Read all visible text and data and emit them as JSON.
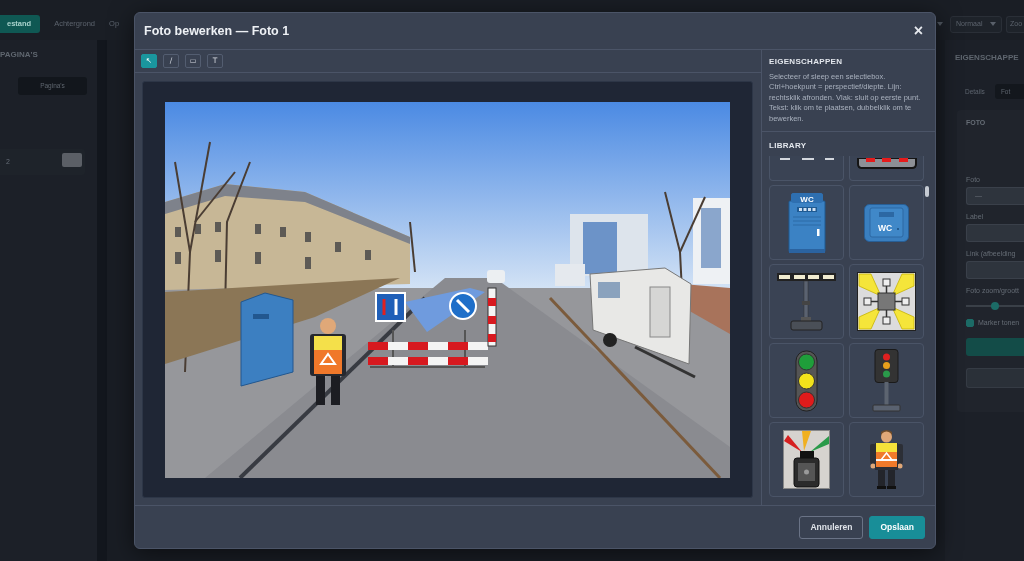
{
  "background_app": {
    "toolbar": [
      {
        "label": "estand",
        "selected": true
      },
      {
        "label": "Achtergrond",
        "selected": false
      },
      {
        "label": "Op",
        "selected": false
      }
    ],
    "view_selects": [
      {
        "label": "Normaal"
      },
      {
        "label": "Zoo"
      }
    ],
    "pages_panel": {
      "title": "PAGINA'S",
      "button": "Pagina's",
      "page_field": {
        "value": "2"
      }
    },
    "properties_panel": {
      "title": "EIGENSCHAPPE",
      "tabs": [
        {
          "label": "Details",
          "selected": false
        },
        {
          "label": "Fot",
          "selected": true
        }
      ],
      "card_title": "FOTO",
      "fields": [
        {
          "kind": "select",
          "label": "Foto",
          "value": "—"
        },
        {
          "kind": "input",
          "label": "Label"
        },
        {
          "kind": "select",
          "label": "Link (afbeelding"
        },
        {
          "kind": "slider",
          "label": "Foto zoom/groott",
          "level": 0.5
        }
      ],
      "marker_checkbox": {
        "label": "Marker tonen",
        "checked": true
      }
    }
  },
  "modal": {
    "title": "Foto bewerken — Foto 1",
    "close": "×",
    "tools": [
      {
        "glyph": "↖",
        "selected": true
      },
      {
        "glyph": "/",
        "selected": false
      },
      {
        "glyph": "▭",
        "selected": false
      },
      {
        "glyph": "T",
        "selected": false
      }
    ],
    "properties": {
      "title": "EIGENSCHAPPEN",
      "hint": "Selecteer of sleep een selectiebox. Ctrl+hoekpunt = perspectief/diepte. Lijn: rechtsklik afronden. Vlak: sluit op eerste punt. Tekst: klik om te plaatsen, dubbelklik om te bewerken."
    },
    "library": {
      "title": "LIBRARY",
      "items": [
        {
          "kind": "dashed-line"
        },
        {
          "kind": "light-bar"
        },
        {
          "kind": "portable-toilet",
          "text": "WC"
        },
        {
          "kind": "toilet-sign",
          "text": "WC"
        },
        {
          "kind": "light-tower"
        },
        {
          "kind": "floodlight"
        },
        {
          "kind": "traffic-light"
        },
        {
          "kind": "signal-post"
        },
        {
          "kind": "beacon"
        },
        {
          "kind": "traffic-worker"
        }
      ]
    },
    "buttons": [
      {
        "label": "Annuleren",
        "kind": "secondary"
      },
      {
        "label": "Opslaan",
        "kind": "primary"
      }
    ]
  }
}
